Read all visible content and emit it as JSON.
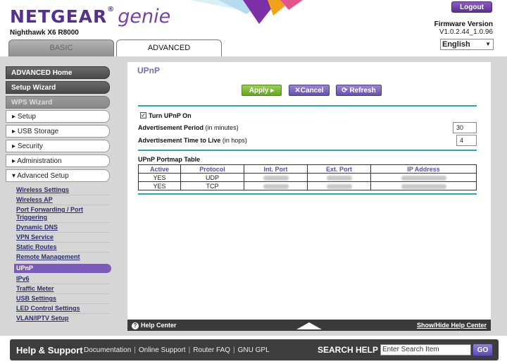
{
  "header": {
    "brand": "NETGEAR",
    "brand_suffix": "genie",
    "model": "Nighthawk X6 R8000",
    "logout_label": "Logout",
    "firmware_label": "Firmware Version",
    "firmware_value": "V1.0.2.44_1.0.96",
    "language": "English",
    "tabs": [
      {
        "label": "BASIC",
        "active": false
      },
      {
        "label": "ADVANCED",
        "active": true
      }
    ]
  },
  "sidebar": {
    "main_items": [
      {
        "label": "ADVANCED Home"
      },
      {
        "label": "Setup Wizard"
      },
      {
        "label": "WPS Wizard"
      },
      {
        "label": "Setup"
      },
      {
        "label": "USB Storage"
      },
      {
        "label": "Security"
      },
      {
        "label": "Administration"
      },
      {
        "label": "Advanced Setup"
      }
    ],
    "sub_items": [
      {
        "label": "Wireless Settings"
      },
      {
        "label": "Wireless AP"
      },
      {
        "label": "Port Forwarding / Port Triggering"
      },
      {
        "label": "Dynamic DNS"
      },
      {
        "label": "VPN Service"
      },
      {
        "label": "Static Routes"
      },
      {
        "label": "Remote Management"
      },
      {
        "label": "UPnP",
        "active": true
      },
      {
        "label": "IPv6"
      },
      {
        "label": "Traffic Meter"
      },
      {
        "label": "USB Settings"
      },
      {
        "label": "LED Control Settings"
      },
      {
        "label": "VLAN/IPTV Setup"
      }
    ]
  },
  "main": {
    "title": "UPnP",
    "buttons": {
      "apply": "Apply ▸",
      "cancel": "✕Cancel",
      "refresh": "⟳ Refresh"
    },
    "turn_on_label": "Turn UPnP On",
    "turn_on_checked": true,
    "ad_period_label": "Advertisement Period",
    "ad_period_unit": "(in minutes)",
    "ad_period_value": "30",
    "ttl_label": "Advertisement Time to Live",
    "ttl_unit": "(in hops)",
    "ttl_value": "4",
    "table_title": "UPnP Portmap Table",
    "table_headers": [
      "Active",
      "Protocol",
      "Int. Port",
      "Ext. Port",
      "IP Address"
    ],
    "table_rows": [
      {
        "active": "YES",
        "protocol": "UDP"
      },
      {
        "active": "YES",
        "protocol": "TCP"
      }
    ]
  },
  "helpbar": {
    "left": "Help Center",
    "right": "Show/Hide Help Center"
  },
  "footer": {
    "title": "Help & Support",
    "links": [
      "Documentation",
      "Online Support",
      "Router FAQ",
      "GNU GPL"
    ],
    "search_label": "SEARCH HELP",
    "search_placeholder": "Enter Search Item",
    "go_label": "GO"
  },
  "colors": {
    "brand_purple": "#55318c",
    "teal_rule": "#2aa3b7",
    "apply_green": "#64a521",
    "active_purple": "#7a5cb8"
  }
}
